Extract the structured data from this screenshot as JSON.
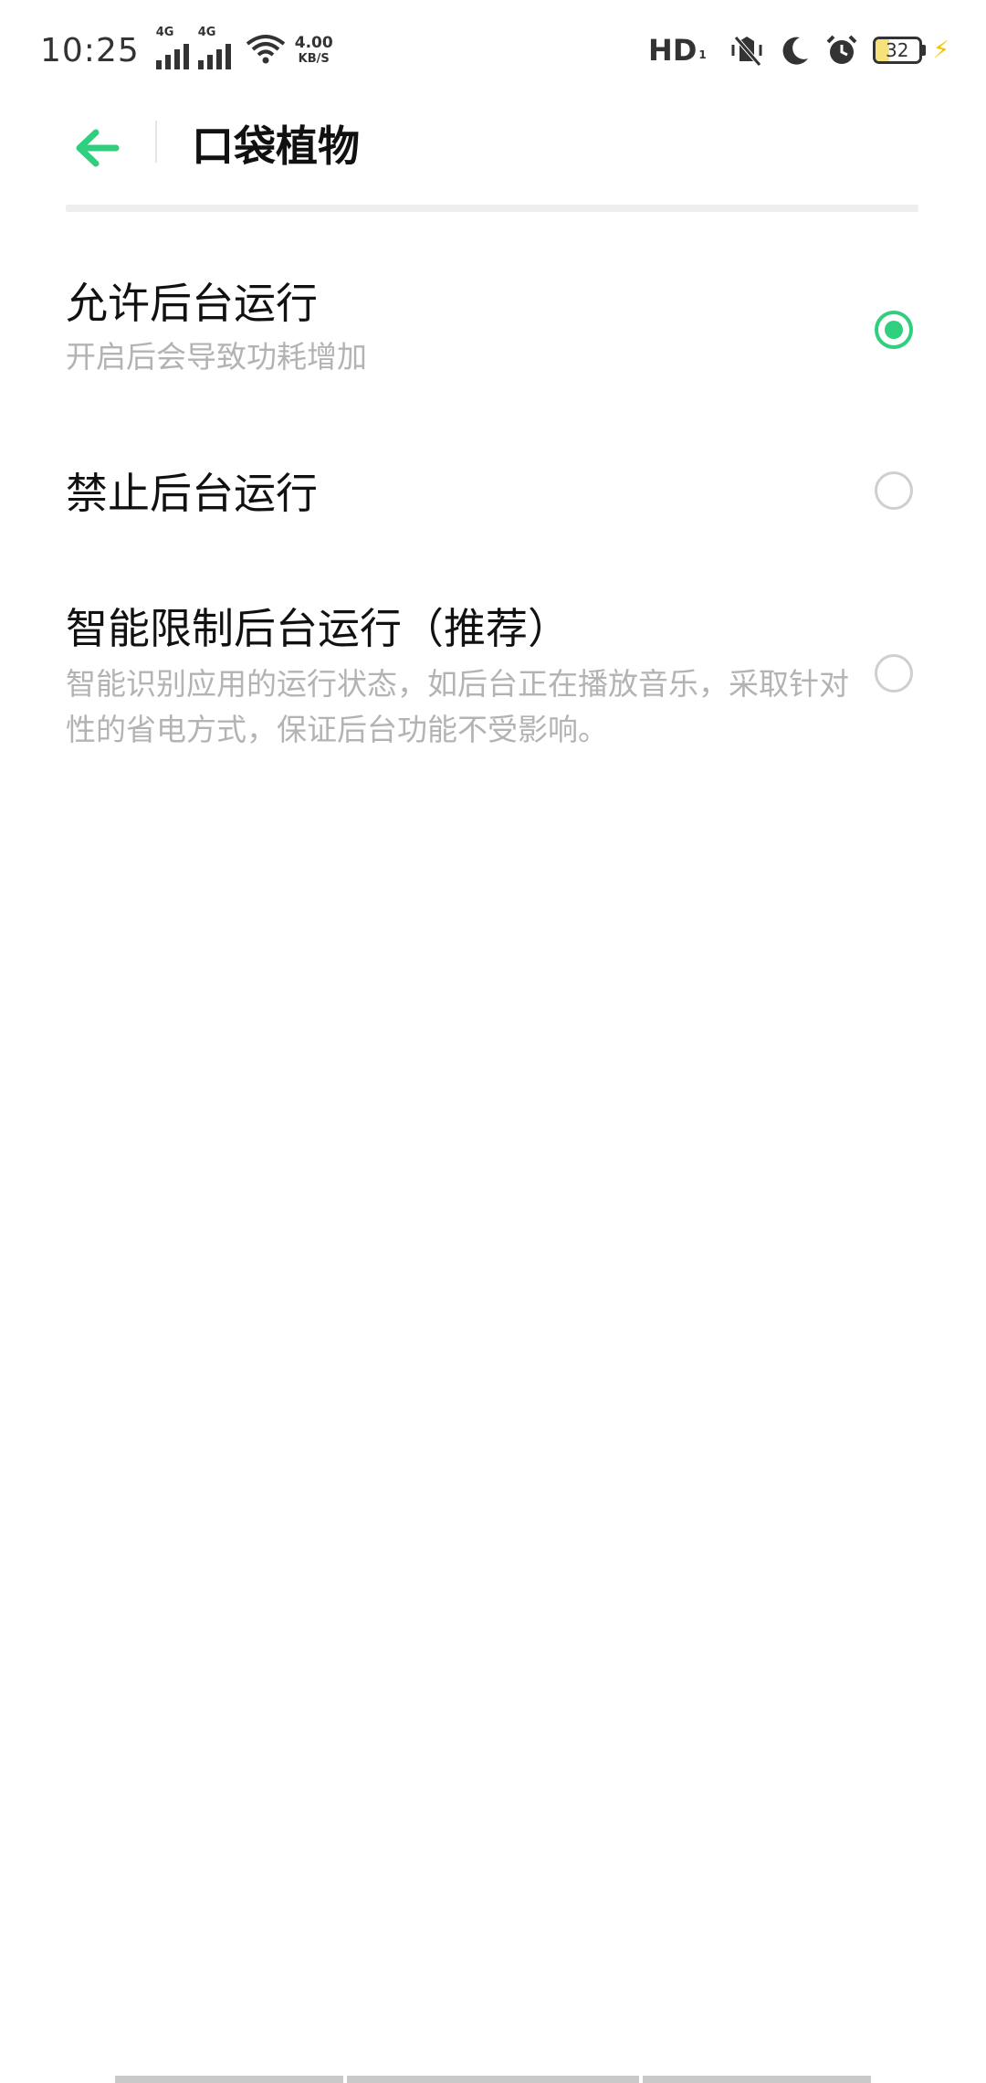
{
  "status_bar": {
    "time": "10:25",
    "signal1_label": "4G",
    "signal2_label": "4G",
    "net_speed_value": "4.00",
    "net_speed_unit": "KB/S",
    "hd_label": "HD",
    "hd_sub": "1",
    "battery_level": "32",
    "icons": [
      "signal-icon",
      "signal-icon",
      "wifi-icon",
      "vibrate-icon",
      "moon-icon",
      "alarm-icon",
      "battery-icon",
      "charging-icon"
    ]
  },
  "header": {
    "back_icon": "back-arrow-icon",
    "title": "口袋植物"
  },
  "options": [
    {
      "title": "允许后台运行",
      "description": "开启后会导致功耗增加",
      "selected": true
    },
    {
      "title": "禁止后台运行",
      "description": "",
      "selected": false
    },
    {
      "title": "智能限制后台运行（推荐）",
      "description": "智能识别应用的运行状态，如后台正在播放音乐，采取针对性的省电方式，保证后台功能不受影响。",
      "selected": false
    }
  ],
  "colors": {
    "accent": "#2fcf7d",
    "primary_text": "#111111",
    "secondary_text": "#b3b3b3",
    "radio_unselected": "#cfcfcf"
  }
}
